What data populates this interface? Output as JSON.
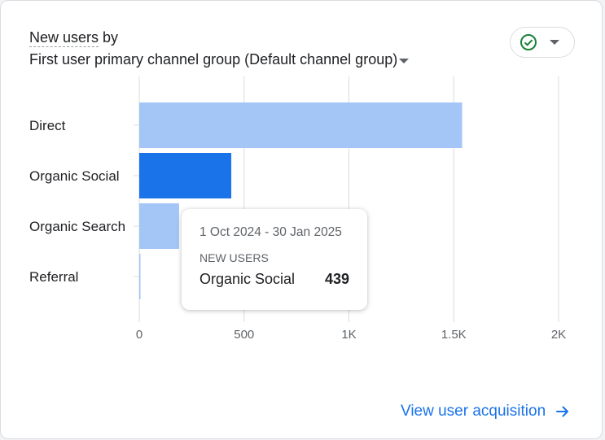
{
  "card": {
    "metric_label": "New users",
    "by_word": "by",
    "dimension_label": "First user primary channel group (Default channel group)",
    "footer_link": "View user acquisition"
  },
  "tooltip": {
    "date_range": "1 Oct 2024 - 30 Jan 2025",
    "metric": "NEW USERS",
    "category": "Organic Social",
    "value": "439"
  },
  "colors": {
    "bar": "#a3c6f7",
    "bar_highlight": "#1a73e8",
    "grid": "#dadce0",
    "check": "#188038",
    "link": "#1a73e8"
  },
  "chart_data": {
    "type": "bar",
    "orientation": "horizontal",
    "categories": [
      "Direct",
      "Organic Social",
      "Organic Search",
      "Referral"
    ],
    "values": [
      1540,
      439,
      190,
      5
    ],
    "highlighted_category": "Organic Social",
    "x_ticks": [
      0,
      500,
      1000,
      1500,
      2000
    ],
    "x_tick_labels": [
      "0",
      "500",
      "1K",
      "1.5K",
      "2K"
    ],
    "xlim": [
      0,
      2000
    ],
    "grid": true,
    "title": "",
    "xlabel": "",
    "ylabel": ""
  }
}
